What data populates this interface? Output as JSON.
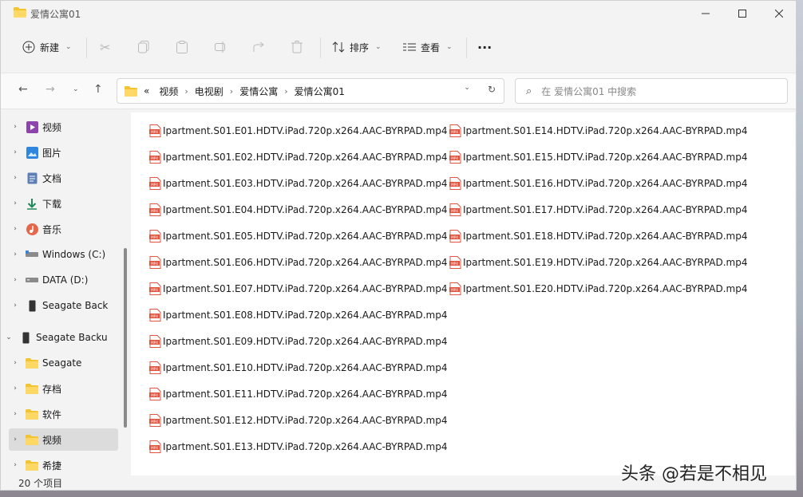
{
  "window": {
    "title": "爱情公寓01"
  },
  "toolbar": {
    "new_label": "新建",
    "sort_label": "排序",
    "view_label": "查看",
    "more_label": "···"
  },
  "address": {
    "overflow": "«",
    "crumbs": [
      "视频",
      "电视剧",
      "爱情公寓",
      "爱情公寓01"
    ]
  },
  "search": {
    "placeholder": "在 爱情公寓01 中搜索"
  },
  "sidebar": {
    "items": [
      {
        "label": "视频",
        "icon": "video-icon"
      },
      {
        "label": "图片",
        "icon": "picture-icon"
      },
      {
        "label": "文档",
        "icon": "document-icon"
      },
      {
        "label": "下载",
        "icon": "download-icon"
      },
      {
        "label": "音乐",
        "icon": "music-icon"
      },
      {
        "label": "Windows (C:)",
        "icon": "drive-icon"
      },
      {
        "label": "DATA (D:)",
        "icon": "drive-icon"
      },
      {
        "label": "Seagate Back",
        "icon": "external-drive-icon"
      },
      {
        "label": "Seagate Backu",
        "icon": "external-drive-icon"
      },
      {
        "label": "Seagate",
        "icon": "folder-icon"
      },
      {
        "label": "存档",
        "icon": "folder-icon"
      },
      {
        "label": "软件",
        "icon": "folder-icon"
      },
      {
        "label": "视频",
        "icon": "folder-icon"
      },
      {
        "label": "希捷",
        "icon": "folder-icon"
      }
    ]
  },
  "files": [
    "Ipartment.S01.E01.HDTV.iPad.720p.x264.AAC-BYRPAD.mp4",
    "Ipartment.S01.E02.HDTV.iPad.720p.x264.AAC-BYRPAD.mp4",
    "Ipartment.S01.E03.HDTV.iPad.720p.x264.AAC-BYRPAD.mp4",
    "Ipartment.S01.E04.HDTV.iPad.720p.x264.AAC-BYRPAD.mp4",
    "Ipartment.S01.E05.HDTV.iPad.720p.x264.AAC-BYRPAD.mp4",
    "Ipartment.S01.E06.HDTV.iPad.720p.x264.AAC-BYRPAD.mp4",
    "Ipartment.S01.E07.HDTV.iPad.720p.x264.AAC-BYRPAD.mp4",
    "Ipartment.S01.E08.HDTV.iPad.720p.x264.AAC-BYRPAD.mp4",
    "Ipartment.S01.E09.HDTV.iPad.720p.x264.AAC-BYRPAD.mp4",
    "Ipartment.S01.E10.HDTV.iPad.720p.x264.AAC-BYRPAD.mp4",
    "Ipartment.S01.E11.HDTV.iPad.720p.x264.AAC-BYRPAD.mp4",
    "Ipartment.S01.E12.HDTV.iPad.720p.x264.AAC-BYRPAD.mp4",
    "Ipartment.S01.E13.HDTV.iPad.720p.x264.AAC-BYRPAD.mp4",
    "Ipartment.S01.E14.HDTV.iPad.720p.x264.AAC-BYRPAD.mp4",
    "Ipartment.S01.E15.HDTV.iPad.720p.x264.AAC-BYRPAD.mp4",
    "Ipartment.S01.E16.HDTV.iPad.720p.x264.AAC-BYRPAD.mp4",
    "Ipartment.S01.E17.HDTV.iPad.720p.x264.AAC-BYRPAD.mp4",
    "Ipartment.S01.E18.HDTV.iPad.720p.x264.AAC-BYRPAD.mp4",
    "Ipartment.S01.E19.HDTV.iPad.720p.x264.AAC-BYRPAD.mp4",
    "Ipartment.S01.E20.HDTV.iPad.720p.x264.AAC-BYRPAD.mp4"
  ],
  "status": {
    "count_text": "20 个项目"
  },
  "watermark": {
    "text": "头条 @若是不相见"
  },
  "colors": {
    "folder": "#f4c430",
    "mp4_badge": "#e0543f",
    "selected": "#dcdcdc"
  }
}
